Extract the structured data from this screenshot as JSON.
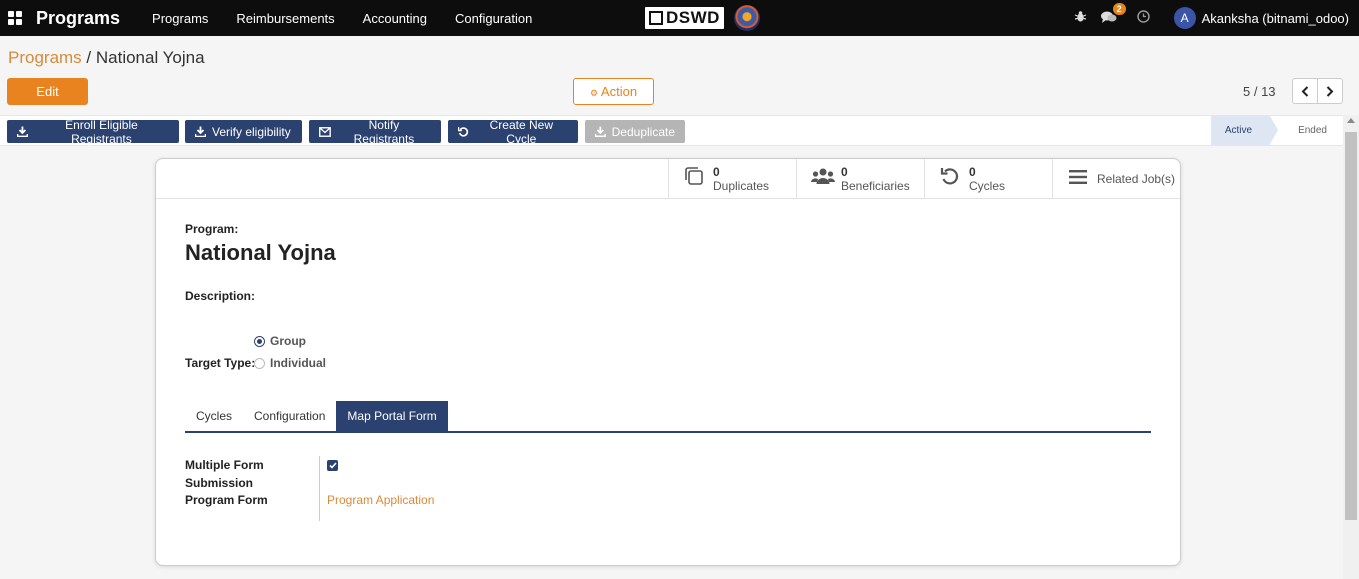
{
  "navbar": {
    "app_title": "Programs",
    "menu": [
      "Programs",
      "Reimbursements",
      "Accounting",
      "Configuration"
    ],
    "logo_text": "DSWD",
    "message_count": "2",
    "user_initial": "A",
    "user_name": "Akanksha (bitnami_odoo)"
  },
  "breadcrumb": {
    "parent": "Programs",
    "separator": " / ",
    "current": "National Yojna"
  },
  "control": {
    "edit_label": "Edit",
    "action_label": "Action",
    "pager": "5 / 13"
  },
  "header_buttons": {
    "enroll": "Enroll Eligible Registrants",
    "verify": "Verify eligibility",
    "notify": "Notify Registrants",
    "create_cycle": "Create New Cycle",
    "deduplicate": "Deduplicate"
  },
  "statusbar": {
    "active": "Active",
    "ended": "Ended"
  },
  "stats": {
    "duplicates_count": "0",
    "duplicates_label": "Duplicates",
    "beneficiaries_count": "0",
    "beneficiaries_label": "Beneficiaries",
    "cycles_count": "0",
    "cycles_label": "Cycles",
    "related_jobs_label": "Related Job(s)"
  },
  "form": {
    "program_label": "Program:",
    "program_name": "National Yojna",
    "description_label": "Description:",
    "target_type_label": "Target Type:",
    "target_options": [
      "Group",
      "Individual"
    ],
    "target_selected": "Group"
  },
  "tabs": [
    "Cycles",
    "Configuration",
    "Map Portal Form"
  ],
  "active_tab": "Map Portal Form",
  "portal": {
    "multiple_form_label_line1": "Multiple Form",
    "multiple_form_label_line2": "Submission",
    "multiple_form_checked": true,
    "program_form_label": "Program Form",
    "program_form_value": "Program Application"
  },
  "colors": {
    "primary": "#2b4170",
    "accent": "#e8831f",
    "link": "#d98a3a"
  }
}
